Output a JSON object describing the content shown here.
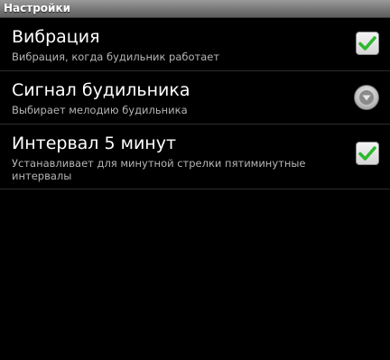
{
  "app": {
    "title": "Настройки"
  },
  "preferences": [
    {
      "title": "Вибрация",
      "summary": "Вибрация, когда будильник работает",
      "control": "checkbox",
      "checked": true
    },
    {
      "title": "Сигнал будильника",
      "summary": "Выбирает мелодию будильника",
      "control": "dropdown"
    },
    {
      "title": "Интервал 5 минут",
      "summary": "Устанавливает для минутной стрелки пятиминутные интервалы",
      "control": "checkbox",
      "checked": true
    }
  ],
  "colors": {
    "background": "#000000",
    "check": "#2eb82e",
    "summary_text": "#b5b5b5"
  },
  "icons": {
    "checkbox": "green-check-icon",
    "dropdown": "chevron-down-circle-icon"
  }
}
